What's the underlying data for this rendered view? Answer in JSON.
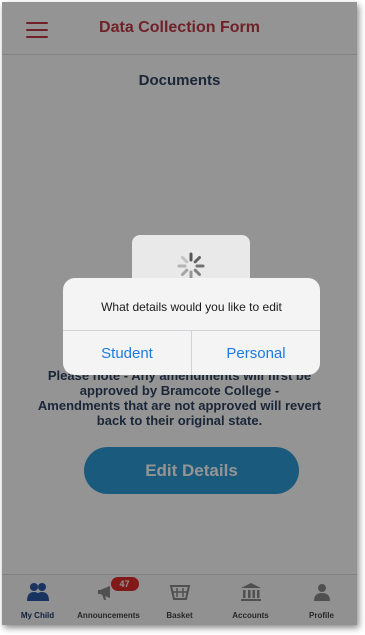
{
  "header": {
    "title": "Data Collection Form"
  },
  "page": {
    "section_title": "Documents",
    "note_lines": [
      "Please note - Any amendments will first be",
      "approved by Bramcote College -",
      "Amendments that are not approved will revert",
      "back to their original state."
    ],
    "edit_button": "Edit Details"
  },
  "dialog": {
    "message": "What details would you like to edit",
    "options": [
      "Student",
      "Personal"
    ]
  },
  "tabbar": {
    "items": [
      {
        "label": "My Child",
        "icon": "users-icon",
        "active": true
      },
      {
        "label": "Announcements",
        "icon": "megaphone-icon",
        "badge": "47"
      },
      {
        "label": "Basket",
        "icon": "basket-icon"
      },
      {
        "label": "Accounts",
        "icon": "bank-icon"
      },
      {
        "label": "Profile",
        "icon": "profile-icon"
      }
    ]
  },
  "colors": {
    "brand_red": "#c23a45",
    "navy": "#2f4461",
    "button_blue": "#2e9bd6",
    "ios_blue": "#1a7ae0",
    "badge_red": "#e02b2b"
  }
}
